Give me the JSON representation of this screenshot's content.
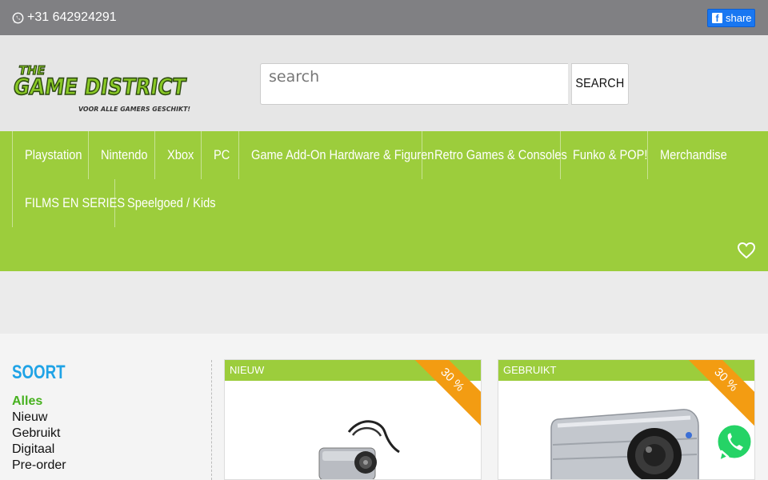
{
  "topbar": {
    "phone": "+31 642924291",
    "share_label": "share"
  },
  "header": {
    "logo_text_top": "THE",
    "logo_text_main": "GAME DISTRICT",
    "logo_tagline": "VOOR ALLE GAMERS GESCHIKT!",
    "search_placeholder": "search",
    "search_button": "SEARCH"
  },
  "nav": {
    "items": [
      {
        "label": "Playstation"
      },
      {
        "label": "Nintendo"
      },
      {
        "label": "Xbox"
      },
      {
        "label": "PC"
      },
      {
        "label": "Game Add-On Hardware & Figuren"
      },
      {
        "label": "Retro Games & Consoles"
      },
      {
        "label": "Funko & POP!"
      },
      {
        "label": "Merchandise"
      },
      {
        "label": "FILMS EN SERIES"
      },
      {
        "label": "Speelgoed / Kids"
      }
    ]
  },
  "sidebar": {
    "title": "SOORT",
    "options": [
      "Alles",
      "Nieuw",
      "Gebruikt",
      "Digitaal",
      "Pre-order"
    ],
    "active": "Alles"
  },
  "products": [
    {
      "condition": "NIEUW",
      "discount": "30 %"
    },
    {
      "condition": "GEBRUIKT",
      "discount": "30 %"
    }
  ],
  "colors": {
    "topbar": "#808083",
    "nav_green": "#9ccd3c",
    "accent_blue": "#1fa3e6",
    "ribbon_orange": "#f39c12",
    "whatsapp": "#25d366"
  }
}
